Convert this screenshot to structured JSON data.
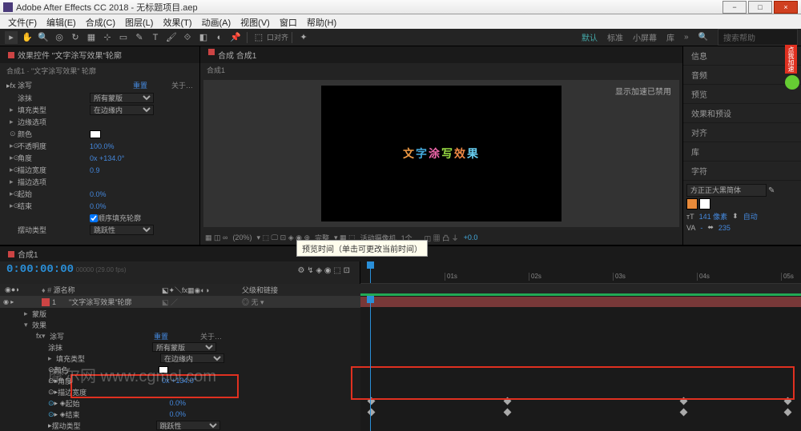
{
  "window": {
    "title": "Adobe After Effects CC 2018 - 无标题项目.aep"
  },
  "menubar": [
    "文件(F)",
    "编辑(E)",
    "合成(C)",
    "图层(L)",
    "效果(T)",
    "动画(A)",
    "视图(V)",
    "窗口",
    "帮助(H)"
  ],
  "toolbar": {
    "align_label": "口对齐",
    "workspaces": [
      "默认",
      "标准",
      "小屏幕",
      "库"
    ],
    "search_placeholder": "搜索帮助"
  },
  "effects_panel": {
    "title": "效果控件 \"文字涂写效果\"轮廓",
    "breadcrumb": "合成1 · \"文字涂写效果\" 轮廓",
    "col_reset": "重置",
    "col_about": "关于…",
    "fx_name": "涂写",
    "props": {
      "tuxie": {
        "label": "涂抹",
        "val": "所有蒙版"
      },
      "filltype": {
        "label": "填充类型",
        "val": "在边缘内"
      },
      "edge_opt": "边缘选项",
      "color": {
        "label": "颜色"
      },
      "opacity": {
        "label": "不透明度",
        "val": "100.0%"
      },
      "angle": {
        "label": "角度",
        "val": "0x +134.0°"
      },
      "stroke_w": {
        "label": "描边宽度",
        "val": "0.9"
      },
      "stroke_opt": "描边选项",
      "start": {
        "label": "起始",
        "val": "0.0%"
      },
      "end": {
        "label": "结束",
        "val": "0.0%"
      },
      "seq_fill": "顺序填充轮廓",
      "wiggle_type": {
        "label": "摆动类型",
        "val": "跳跃性"
      }
    }
  },
  "viewer": {
    "tab": "合成 合成1",
    "sub": "合成1",
    "gpu_msg": "显示加速已禁用",
    "footer": {
      "zoom": "(20%)",
      "res": "完整",
      "cam": "活动摄像机",
      "views": "1个…",
      "exp": "+0.0"
    }
  },
  "right_panel": {
    "items": [
      "信息",
      "音频",
      "预览",
      "效果和预设",
      "对齐",
      "库",
      "字符"
    ],
    "font": "方正正大黑简体",
    "size_label": "141 像素",
    "leading": "自动",
    "tracking": "235"
  },
  "timeline": {
    "tab": "合成1",
    "timecode": "0:00:00:00",
    "cols": {
      "src": "源名称",
      "parent": "父级和链接"
    },
    "layer1": {
      "num": "1",
      "name": "\"文字涂写效果\"轮廓",
      "parent": "无"
    },
    "ruler": [
      "01s",
      "02s",
      "03s",
      "04s",
      "05s"
    ],
    "sub": {
      "mask": "蒙版",
      "fx": "效果",
      "tuxie": "涂写",
      "reset": "重置",
      "about": "关于…",
      "tumo": {
        "label": "涂抹",
        "val": "所有蒙版"
      },
      "filltype": {
        "label": "填充类型",
        "val": "在边缘内"
      },
      "color": "颜色",
      "angle": {
        "label": "角度",
        "val": "0x +134.0°"
      },
      "stroke_w": {
        "label": "描边宽度"
      },
      "start": {
        "label": "起始",
        "val": "0.0%"
      },
      "end": {
        "label": "结束",
        "val": "0.0%"
      },
      "wiggle": {
        "label": "摆动类型",
        "val": "跳跃性"
      }
    }
  },
  "tooltip": "预览时间（单击可更改当前时间）",
  "watermark": "摩尔网 www.cgmol.com",
  "badge_text": "点我加速"
}
